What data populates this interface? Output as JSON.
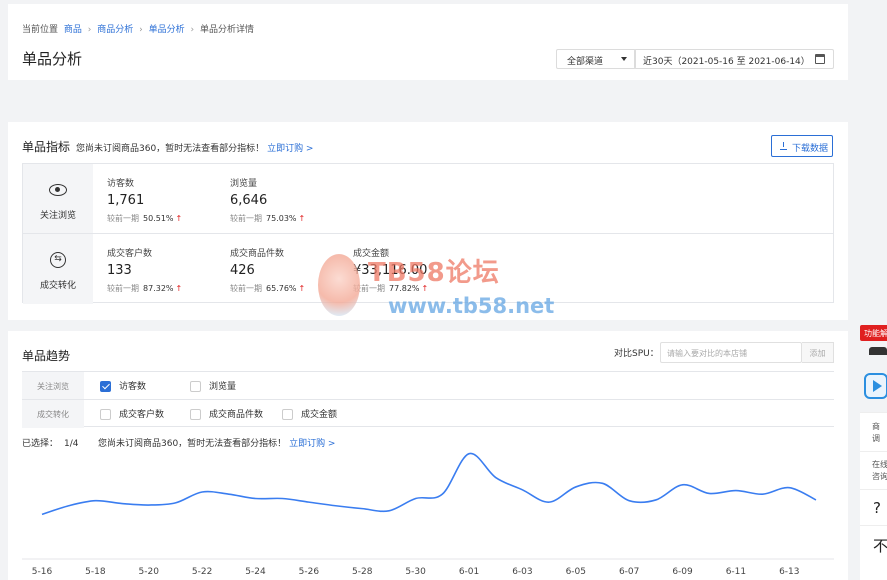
{
  "breadcrumb": {
    "prefix": "当前位置",
    "items": [
      "商品",
      "商品分析",
      "单品分析"
    ],
    "current": "单品分析详情"
  },
  "page_title": "单品分析",
  "channel_select": {
    "value": "全部渠道"
  },
  "date_range": {
    "value": "近30天（2021-05-16 至 2021-06-14）"
  },
  "indicators": {
    "title": "单品指标",
    "notice": "您尚未订阅商品360，暂时无法查看部分指标！",
    "subscribe_link": "立即订购 >",
    "download_label": "下载数据",
    "compare_label": "较前一期",
    "groups": [
      {
        "label": "关注浏览",
        "icon": "eye-icon",
        "metrics": [
          {
            "name": "访客数",
            "value": "1,761",
            "change": "50.51%",
            "trend": "up"
          },
          {
            "name": "浏览量",
            "value": "6,646",
            "change": "75.03%",
            "trend": "up"
          }
        ]
      },
      {
        "label": "成交转化",
        "icon": "conversion-icon",
        "metrics": [
          {
            "name": "成交客户数",
            "value": "133",
            "change": "87.32%",
            "trend": "up"
          },
          {
            "name": "成交商品件数",
            "value": "426",
            "change": "65.76%",
            "trend": "up"
          },
          {
            "name": "成交金额",
            "value": "¥33,116.00",
            "change": "77.82%",
            "trend": "up"
          }
        ]
      }
    ]
  },
  "trend": {
    "title": "单品趋势",
    "compare_spu_label": "对比SPU：",
    "compare_spu_placeholder": "请输入要对比的本店铺",
    "add_label": "添加",
    "filters": [
      {
        "group": "关注浏览",
        "options": [
          {
            "label": "访客数",
            "checked": true
          },
          {
            "label": "浏览量",
            "checked": false
          }
        ]
      },
      {
        "group": "成交转化",
        "options": [
          {
            "label": "成交客户数",
            "checked": false
          },
          {
            "label": "成交商品件数",
            "checked": false
          },
          {
            "label": "成交金额",
            "checked": false
          }
        ]
      }
    ],
    "selected_label": "已选择：",
    "selected_count": "1/4",
    "notice": "您尚未订阅商品360，暂时无法查看部分指标！",
    "subscribe_link": "立即订购 >"
  },
  "chart_data": {
    "type": "line",
    "title": "",
    "x_tick_labels": [
      "5-16",
      "5-18",
      "5-20",
      "5-22",
      "5-24",
      "5-26",
      "5-28",
      "5-30",
      "6-01",
      "6-03",
      "6-05",
      "6-07",
      "6-09",
      "6-11",
      "6-13"
    ],
    "x": [
      "5-16",
      "5-17",
      "5-18",
      "5-19",
      "5-20",
      "5-21",
      "5-22",
      "5-23",
      "5-24",
      "5-25",
      "5-26",
      "5-27",
      "5-28",
      "5-29",
      "5-30",
      "5-31",
      "6-01",
      "6-02",
      "6-03",
      "6-04",
      "6-05",
      "6-06",
      "6-07",
      "6-08",
      "6-09",
      "6-10",
      "6-11",
      "6-12",
      "6-13",
      "6-14"
    ],
    "series": [
      {
        "values": [
          34,
          46,
          53,
          49,
          47,
          50,
          65,
          62,
          56,
          56,
          51,
          46,
          42,
          39,
          56,
          62,
          118,
          85,
          68,
          51,
          72,
          77,
          53,
          54,
          75,
          63,
          67,
          62,
          71,
          54
        ]
      }
    ],
    "y_range": [
      0,
      130
    ],
    "grid": false,
    "line_color": "#3a7df0"
  },
  "side_panel": {
    "tag": "功能解",
    "item1": [
      "商",
      "调"
    ],
    "item2": [
      "在线",
      "咨询"
    ],
    "help": "?",
    "more": "不"
  },
  "watermark": {
    "line1": "TB58论坛",
    "line2": "www.tb58.net"
  }
}
